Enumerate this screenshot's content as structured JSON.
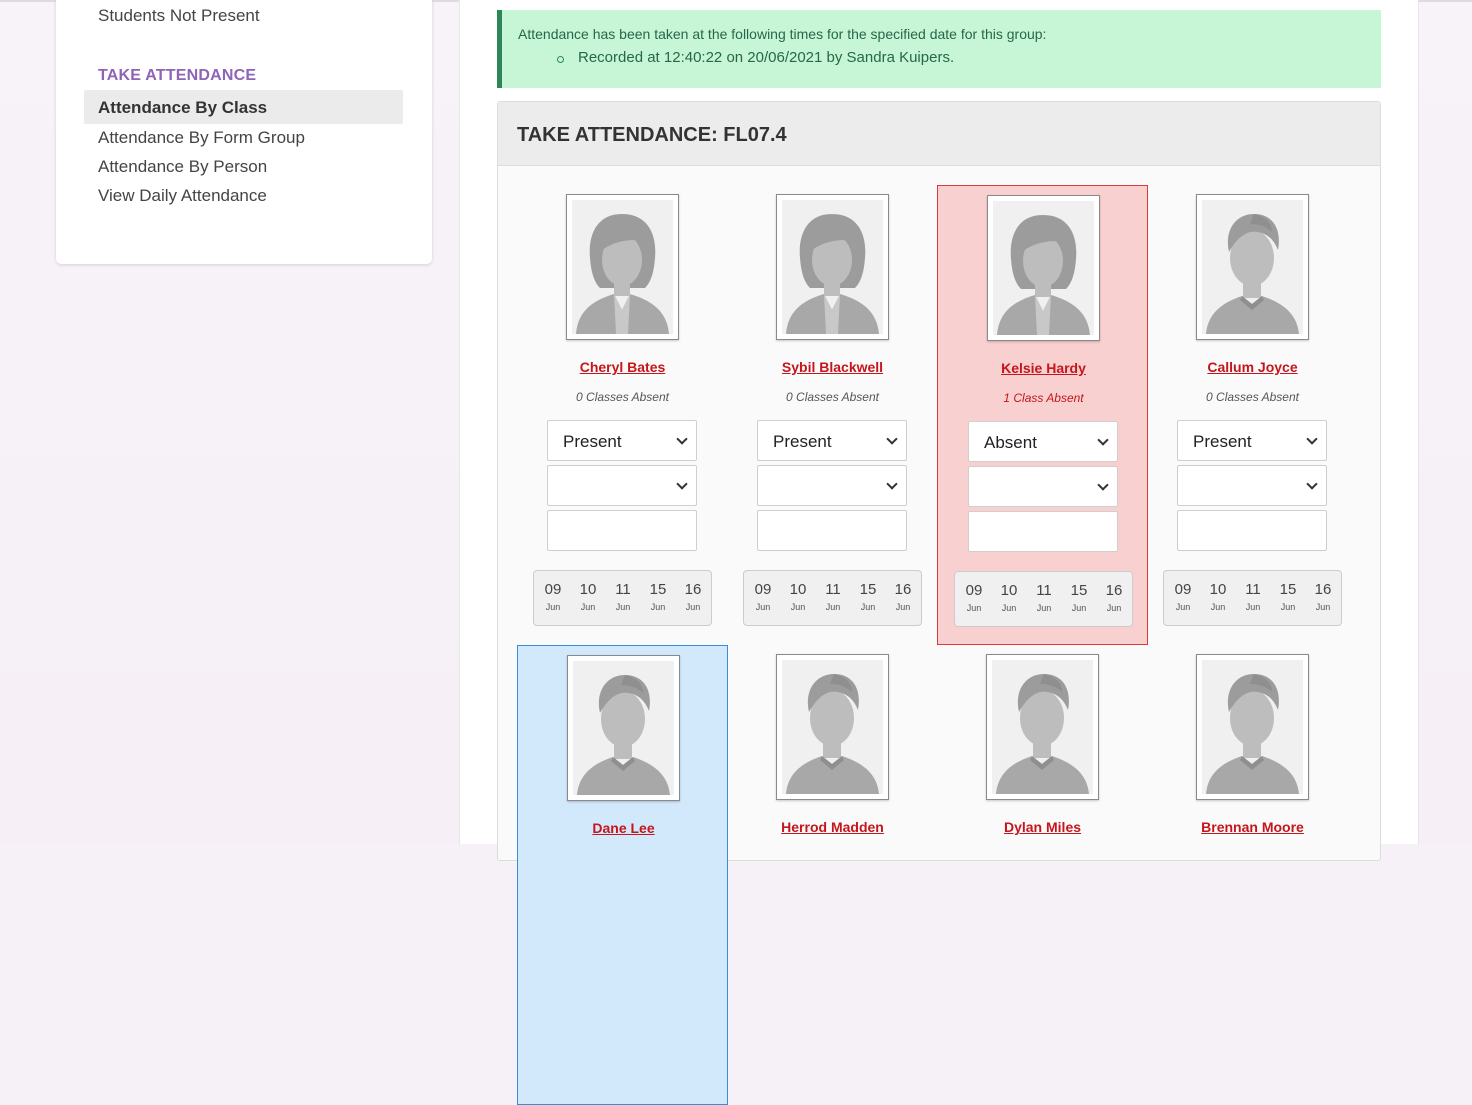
{
  "sidebar": {
    "students_not_present": "Students Not Present",
    "heading": "TAKE ATTENDANCE",
    "links": [
      "Attendance By Class",
      "Attendance By Form Group",
      "Attendance By Person",
      "View Daily Attendance"
    ]
  },
  "alert": {
    "message": "Attendance has been taken at the following times for the specified date for this group:",
    "record": "Recorded at 12:40:22 on 20/06/2021 by Sandra Kuipers."
  },
  "panel": {
    "title": "TAKE ATTENDANCE: FL07.4"
  },
  "students": [
    {
      "name": "Cheryl Bates",
      "absent_count": "0 Classes Absent",
      "status": "Present",
      "gender": "female"
    },
    {
      "name": "Sybil Blackwell",
      "absent_count": "0 Classes Absent",
      "status": "Present",
      "gender": "female"
    },
    {
      "name": "Kelsie Hardy",
      "absent_count": "1 Class Absent",
      "status": "Absent",
      "gender": "female"
    },
    {
      "name": "Callum Joyce",
      "absent_count": "0 Classes Absent",
      "status": "Present",
      "gender": "male"
    },
    {
      "name": "Dane Lee",
      "gender": "male"
    },
    {
      "name": "Herrod Madden",
      "gender": "male"
    },
    {
      "name": "Dylan Miles",
      "gender": "male"
    },
    {
      "name": "Brennan Moore",
      "gender": "male"
    }
  ],
  "dates": [
    {
      "day": "09",
      "month": "Jun"
    },
    {
      "day": "10",
      "month": "Jun"
    },
    {
      "day": "11",
      "month": "Jun"
    },
    {
      "day": "15",
      "month": "Jun"
    },
    {
      "day": "16",
      "month": "Jun"
    }
  ],
  "colors": {
    "accent_purple": "#8e63b8",
    "link_red": "#c4161c",
    "absent_bg": "#f8d0d0",
    "selected_bg": "#d2e8fb",
    "alert_bg": "#c6f6d5"
  }
}
